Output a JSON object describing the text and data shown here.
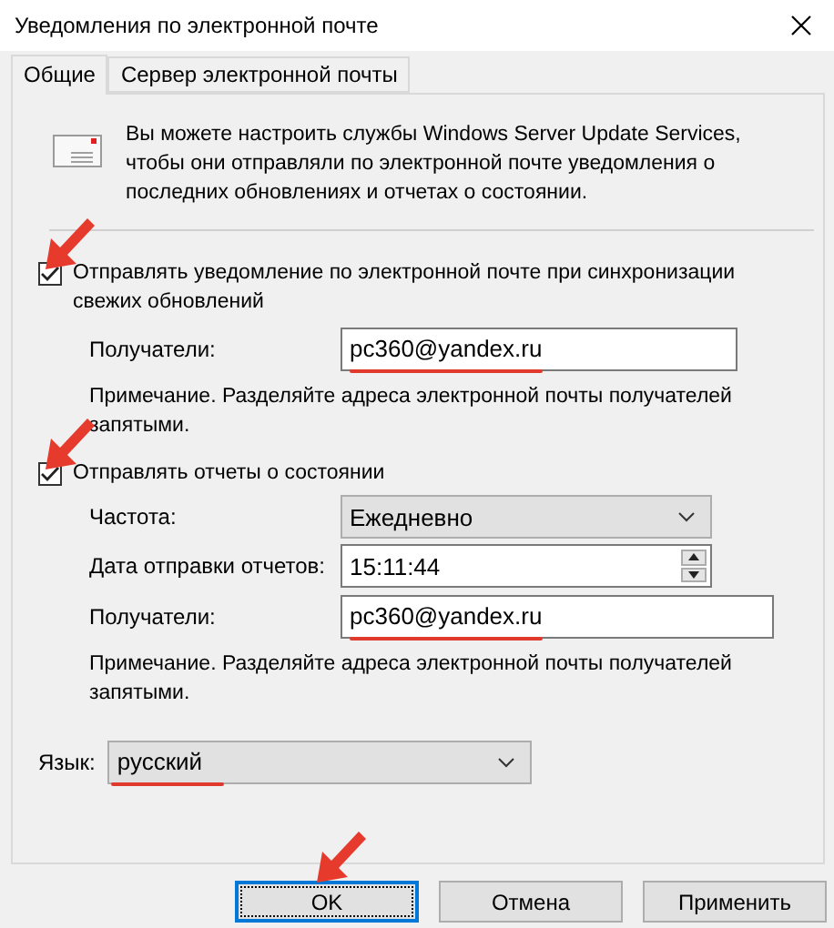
{
  "window": {
    "title": "Уведомления по электронной почте"
  },
  "tabs": [
    {
      "label": "Общие",
      "selected": true
    },
    {
      "label": "Сервер электронной почты",
      "selected": false
    }
  ],
  "intro": "Вы можете настроить службы Windows Server Update Services, чтобы они отправляли по электронной почте уведомления о последних обновлениях и отчетах о состоянии.",
  "sync_notification": {
    "label": "Отправлять уведомление по электронной почте при синхронизации свежих обновлений",
    "checked": true,
    "recipients_label": "Получатели:",
    "recipients": "pc360@yandex.ru",
    "note": "Примечание. Разделяйте адреса электронной почты получателей запятыми."
  },
  "status_reports": {
    "label": "Отправлять отчеты о состоянии",
    "checked": true,
    "frequency_label": "Частота:",
    "frequency": "Ежедневно",
    "send_time_label": "Дата отправки отчетов:",
    "send_time": "15:11:44",
    "recipients_label": "Получатели:",
    "recipients": "pc360@yandex.ru",
    "note": "Примечание. Разделяйте адреса электронной почты получателей запятыми."
  },
  "language": {
    "label": "Язык:",
    "value": "русский"
  },
  "buttons": [
    {
      "label": "OK",
      "default": true
    },
    {
      "label": "Отмена",
      "default": false
    },
    {
      "label": "Применить",
      "default": false
    }
  ]
}
